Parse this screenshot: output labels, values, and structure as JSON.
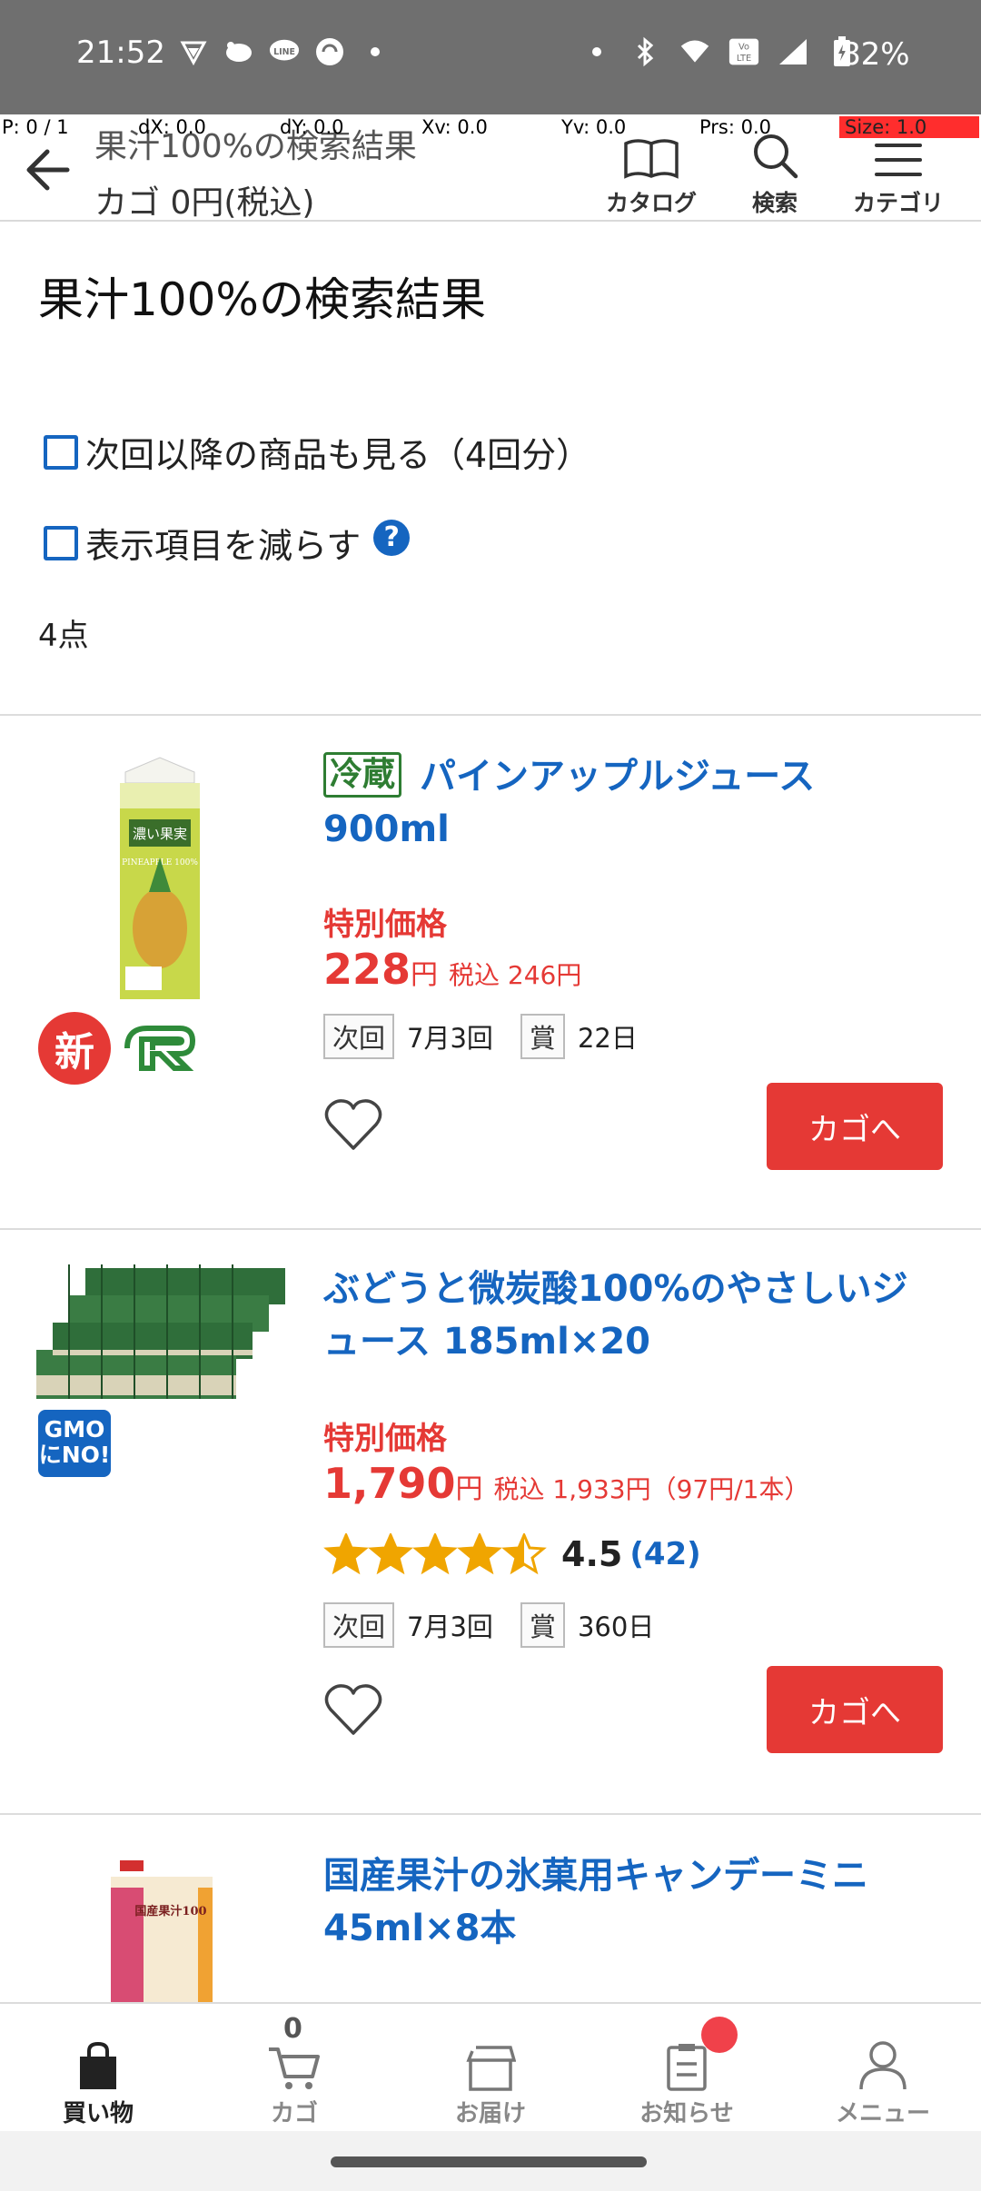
{
  "status_bar": {
    "time": "21:52",
    "battery": "82%",
    "left_icons": [
      "vpn-shield-icon",
      "piggy-icon",
      "line-icon",
      "sync-icon",
      "dot-icon"
    ],
    "right_icons": [
      "dot-icon",
      "bluetooth-icon",
      "wifi-icon",
      "volte-icon",
      "signal-icon",
      "battery-icon"
    ]
  },
  "debug": {
    "p": "P: 0 / 1",
    "dx": "dX: 0.0",
    "dy": "dY: 0.0",
    "xv": "Xv: 0.0",
    "yv": "Yv: 0.0",
    "prs": "Prs: 0.0",
    "size": "Size: 1.0"
  },
  "header": {
    "title": "果汁100%の検索結果",
    "cart_summary": "カゴ 0円(税込)",
    "nav": [
      {
        "label": "カタログ",
        "icon": "book-icon"
      },
      {
        "label": "検索",
        "icon": "search-icon"
      },
      {
        "label": "カテゴリ",
        "icon": "menu-icon"
      }
    ]
  },
  "main": {
    "page_title": "果汁100%の検索結果",
    "option_next": "次回以降の商品も見る（4回分）",
    "option_reduce": "表示項目を減らす",
    "help_symbol": "?",
    "count": "4点"
  },
  "products": [
    {
      "chilled_badge": "冷蔵",
      "title": "パインアップルジュース 900ml",
      "special_label": "特別価格",
      "price": "228",
      "yen": "円",
      "tax_price": "税込 246円",
      "next_label": "次回",
      "next_value": "7月3回",
      "best_label": "賞",
      "best_value": "22日",
      "cart_button": "カゴへ",
      "new_badge": "新",
      "package_text": "濃い果実",
      "package_sub": "PINEAPPLE 100%"
    },
    {
      "title": "ぶどうと微炭酸100%のやさしいジュース 185ml×20",
      "special_label": "特別価格",
      "price": "1,790",
      "yen": "円",
      "tax_price": "税込 1,933円（97円/1本）",
      "rating": 4.5,
      "rating_text": "4.5",
      "review_count": "(42)",
      "next_label": "次回",
      "next_value": "7月3回",
      "best_label": "賞",
      "best_value": "360日",
      "cart_button": "カゴへ",
      "gmo_badge_line1": "GMO",
      "gmo_badge_line2": "にNO!"
    },
    {
      "title": "国産果汁の氷菓用キャンデーミニ 45ml×8本",
      "package_text": "国産果汁100"
    }
  ],
  "bottom_nav": [
    {
      "label": "買い物",
      "icon": "shopping-bag-icon",
      "active": true
    },
    {
      "label": "カゴ",
      "icon": "cart-icon",
      "badge": "0"
    },
    {
      "label": "お届け",
      "icon": "delivery-box-icon"
    },
    {
      "label": "お知らせ",
      "icon": "clipboard-icon",
      "has_notification": true
    },
    {
      "label": "メニュー",
      "icon": "person-icon"
    }
  ],
  "colors": {
    "accent_blue": "#1565c0",
    "price_red": "#e53935",
    "chilled_green": "#2e7d32",
    "status_bar": "#6f6f6f"
  }
}
